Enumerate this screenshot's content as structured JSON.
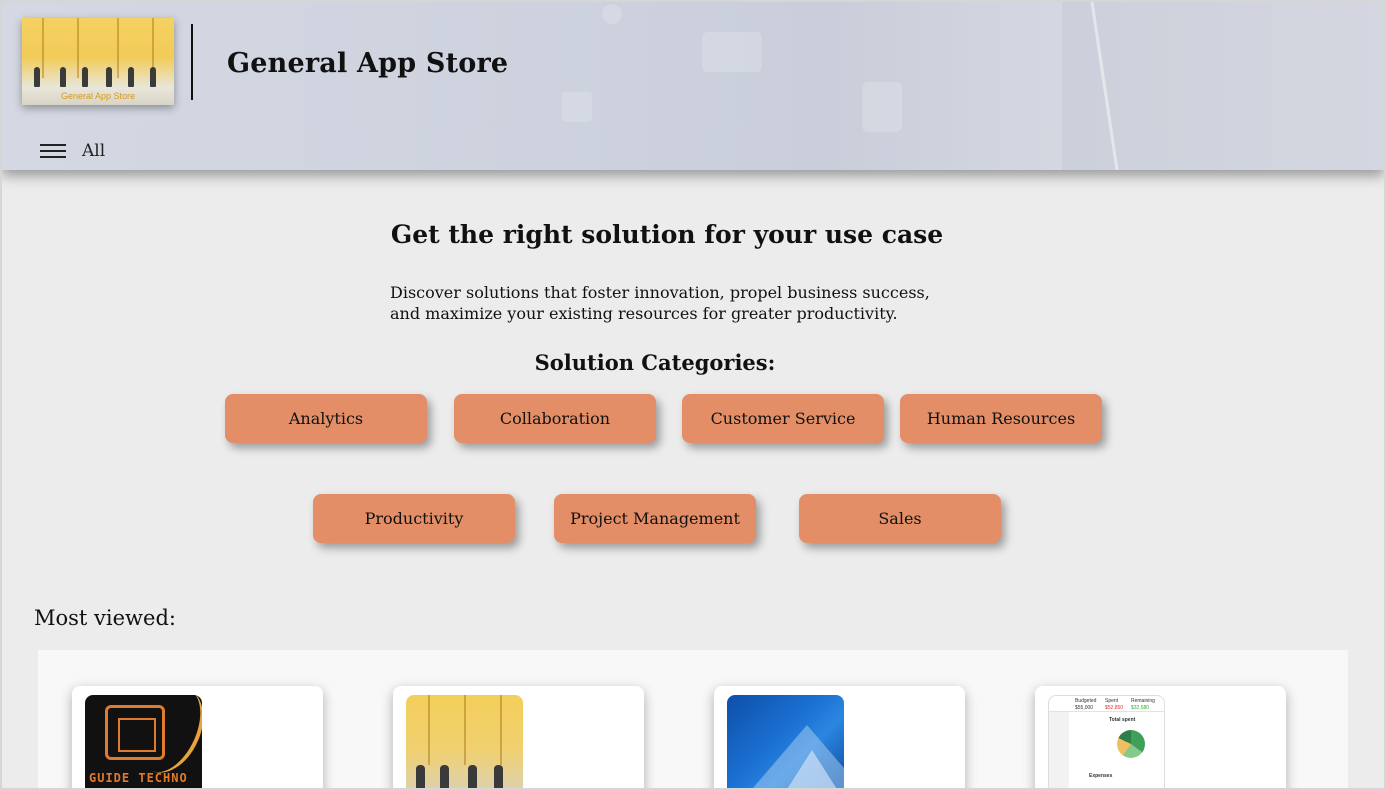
{
  "header": {
    "site_title": "General App Store",
    "logo_text": "General App Store",
    "menu_label": "All"
  },
  "hero": {
    "title": "Get the right solution for your use case",
    "description": "Discover solutions that foster innovation, propel business success, and maximize your existing resources for greater productivity."
  },
  "categories": {
    "heading": "Solution Categories:",
    "items": [
      "Analytics",
      "Collaboration",
      "Customer Service",
      "Human Resources",
      "Productivity",
      "Project Management",
      "Sales"
    ]
  },
  "most_viewed": {
    "heading": "Most viewed:",
    "apps": [
      {
        "thumb_text": "GUIDE TECHNO"
      },
      {
        "thumb_text": ""
      },
      {
        "thumb_text": ""
      },
      {
        "thumb_labels": [
          "Budgeted",
          "Spent",
          "Remaining",
          "Total spent",
          "Expenses"
        ],
        "thumb_values": [
          "$55,000",
          "$52,850",
          "$32,580"
        ]
      }
    ]
  },
  "colors": {
    "category_button": "#e38e66",
    "background": "#ececec"
  }
}
